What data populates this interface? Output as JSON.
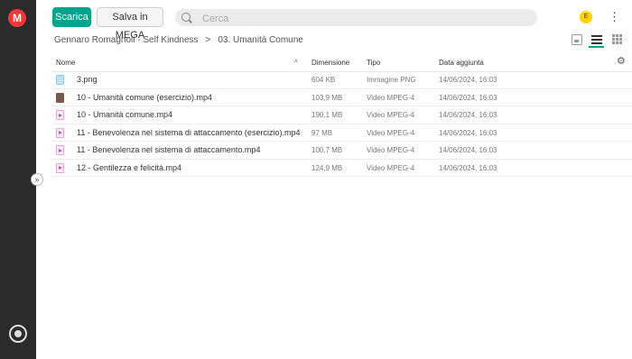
{
  "app": {
    "logo": "M",
    "icons": {
      "logo": "mega-logo-icon",
      "transfer": "transfer-manager-icon",
      "expand": "chevron-double-right-icon",
      "search": "search-icon",
      "more": "kebab-menu-icon",
      "settings": "gear-icon",
      "sort": "chevron-up-icon"
    },
    "colors": {
      "accent": "#00a38c",
      "brand": "#f0373a",
      "sidebar": "#2b2b2b",
      "avatar": "#ffd300"
    }
  },
  "toolbar": {
    "download_label": "Scarica",
    "save_label": "Salva in MEGA",
    "search_placeholder": "Cerca",
    "avatar_initial": "E"
  },
  "breadcrumb": {
    "parent": "Gennaro Romagnoli - Self Kindness",
    "separator": ">",
    "current": "03. Umanità Comune"
  },
  "view": {
    "modes": [
      "thumbnail",
      "list",
      "grid"
    ],
    "selected": "list"
  },
  "table": {
    "headers": {
      "name": "Nome",
      "size": "Dimensione",
      "type": "Tipo",
      "date": "Data aggiunta"
    },
    "rows": [
      {
        "icon": "png",
        "name": "3.png",
        "size": "604 KB",
        "type": "Immagine PNG",
        "date": "14/06/2024, 16:03"
      },
      {
        "icon": "thumb",
        "name": "10 - Umanità comune (esercizio).mp4",
        "size": "103,9 MB",
        "type": "Video MPEG-4",
        "date": "14/06/2024, 16:03"
      },
      {
        "icon": "video",
        "name": "10 - Umanità comune.mp4",
        "size": "190,1 MB",
        "type": "Video MPEG-4",
        "date": "14/06/2024, 16:03"
      },
      {
        "icon": "video",
        "name": "11 - Benevolenza nel sistema di attaccamento (esercizio).mp4",
        "size": "97 MB",
        "type": "Video MPEG-4",
        "date": "14/06/2024, 16:03"
      },
      {
        "icon": "video",
        "name": "11 - Benevolenza nel sistema di attaccamento.mp4",
        "size": "100,7 MB",
        "type": "Video MPEG-4",
        "date": "14/06/2024, 16:03"
      },
      {
        "icon": "video",
        "name": "12 - Gentilezza e felicità.mp4",
        "size": "124,9 MB",
        "type": "Video MPEG-4",
        "date": "14/06/2024, 16:03"
      }
    ]
  }
}
